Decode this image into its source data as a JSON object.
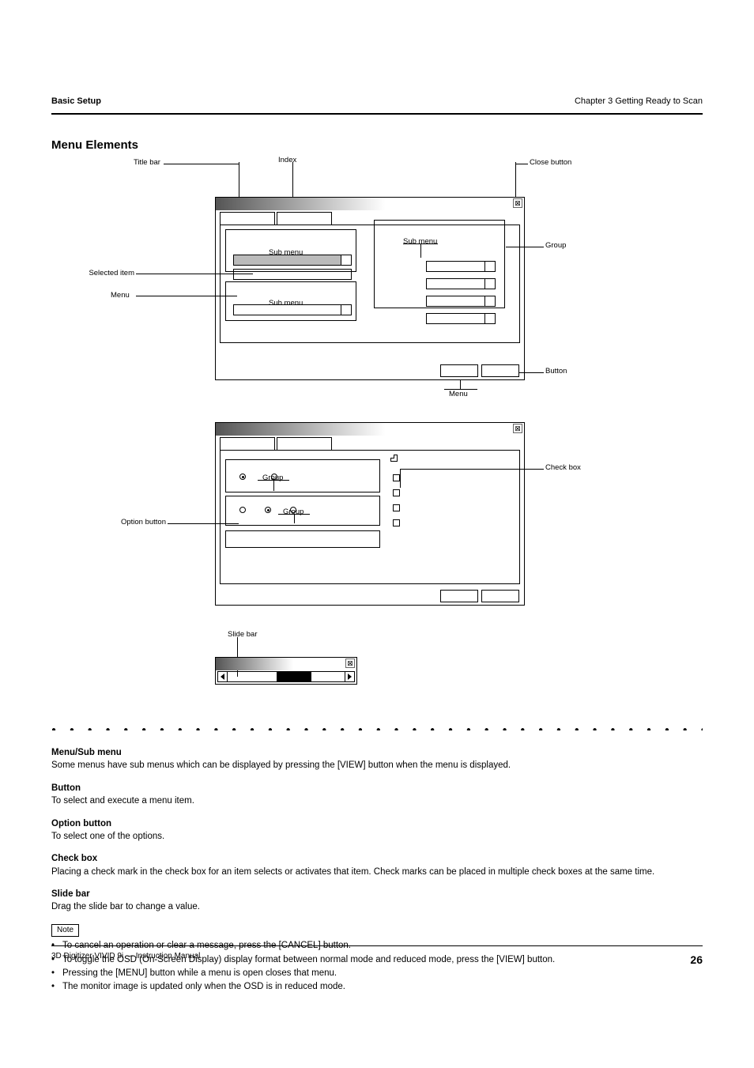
{
  "header": {
    "left": "Basic Setup",
    "right": "Chapter 3 Getting Ready to Scan"
  },
  "section_title": "Menu Elements",
  "footer": {
    "left": "3D Digitizer VIVID 9i   —   Instruction Manual",
    "page": "26"
  },
  "callouts": {
    "title_bar": "Title bar",
    "index": "Index",
    "close_button": "Close button",
    "menu": "Menu",
    "sub_menu": "Sub menu",
    "group": "Group",
    "selected_item": "Selected item",
    "button": "Button",
    "check_box": "Check box",
    "option_button": "Option button",
    "slide_bar": "Slide bar"
  },
  "notes": {
    "n1_title": "Menu/Sub menu",
    "n1_body": "Some menus have sub menus which can be displayed by pressing the [VIEW] button when the menu is displayed.",
    "n2_title": "Button",
    "n2_body": "To select and execute a menu item.",
    "n3_title": "Option button",
    "n3_body": "To select one of the options.",
    "n4_title": "Check box",
    "n4_body": "Placing a check mark in the check box for an item selects or activates that item. Check marks can be placed in multiple check boxes at the same time.",
    "n5_title": "Slide bar",
    "n5_body": "Drag the slide bar to change a value.",
    "note_lead": "Note",
    "note_bullets": [
      "To cancel an operation or clear a message, press the [CANCEL] button.",
      "To toggle the OSD (On-Screen Display) display format between normal mode and reduced mode, press the [VIEW] button.",
      "Pressing the [MENU] button while a menu is open closes that menu.",
      "The monitor image is updated only when the OSD is in reduced mode."
    ]
  }
}
